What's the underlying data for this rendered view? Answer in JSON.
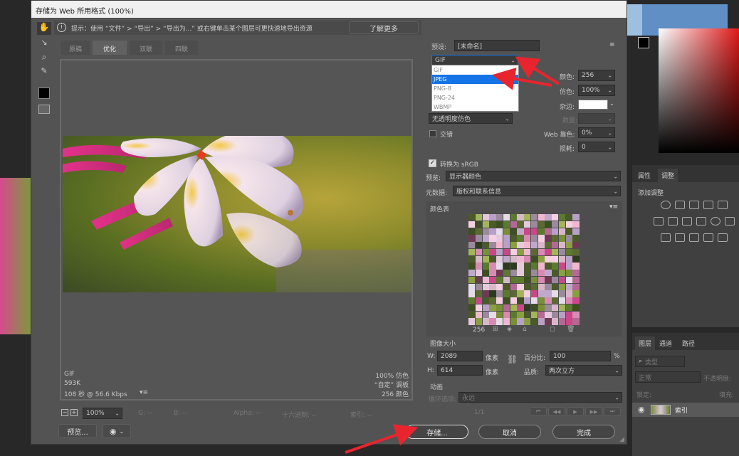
{
  "dialog": {
    "title": "存储为 Web 所用格式 (100%)",
    "hint": "提示：使用 “文件” > “导出” > “导出为...” 或右键单击某个图层可更快速地导出资源",
    "learn_more": "了解更多"
  },
  "tabs": [
    "原稿",
    "优化",
    "双联",
    "四联"
  ],
  "preset": {
    "label": "预设:",
    "value": "[未命名]"
  },
  "format": {
    "selected": "GIF",
    "options": [
      "GIF",
      "JPEG",
      "PNG-8",
      "PNG-24",
      "WBMP"
    ],
    "highlighted": "JPEG"
  },
  "settings": {
    "colors_label": "颜色:",
    "colors_value": "256",
    "dither_label": "仿色:",
    "dither_value": "100%",
    "matte_label": "杂边:",
    "amount_label": "数量:",
    "transparency_dither": "无透明度仿色",
    "interlaced": "交错",
    "web_snap_label": "Web 靠色:",
    "web_snap_value": "0%",
    "lossy_label": "损耗:",
    "lossy_value": "0",
    "convert_srgb": "转换为 sRGB",
    "preview_label": "预览:",
    "preview_value": "显示器颜色",
    "metadata_label": "元数据:",
    "metadata_value": "版权和联系信息"
  },
  "color_table": {
    "title": "颜色表",
    "count": "256"
  },
  "image_size": {
    "title": "图像大小",
    "w_label": "W:",
    "w_value": "2089",
    "w_unit": "像素",
    "h_label": "H:",
    "h_value": "614",
    "h_unit": "像素",
    "percent_label": "百分比:",
    "percent_value": "100",
    "percent_unit": "%",
    "quality_label": "品质:",
    "quality_value": "两次立方"
  },
  "animation": {
    "title": "动画",
    "loop_label": "循环选项:",
    "loop_value": "永远",
    "frame": "1/1"
  },
  "preview_info": {
    "format": "GIF",
    "size": "593K",
    "time": "108 秒 @ 56.6 Kbps",
    "dither": "100% 仿色",
    "palette": "“自定” 调板",
    "colors": "256 颜色"
  },
  "statusbar": {
    "zoom": "100%",
    "g": "G: --",
    "b": "B: --",
    "alpha": "Alpha: --",
    "hex": "十六进制: --",
    "index": "索引: --"
  },
  "buttons": {
    "preview": "预览...",
    "save": "存储...",
    "cancel": "取消",
    "done": "完成"
  },
  "right_panel": {
    "tab_properties": "属性",
    "tab_adjustments": "调整",
    "add_adjustment": "添加调整",
    "tab_layers": "图层",
    "tab_channels": "通道",
    "tab_paths": "路径",
    "kind_placeholder": "类型",
    "blend_mode": "正常",
    "opacity": "不透明度:",
    "lock": "锁定:",
    "fill": "填充:",
    "layer_name": "索引"
  },
  "colors": {
    "accent_blue": "#1473e6",
    "arrow_red": "#e8252e",
    "dialog_bg": "#535353"
  }
}
